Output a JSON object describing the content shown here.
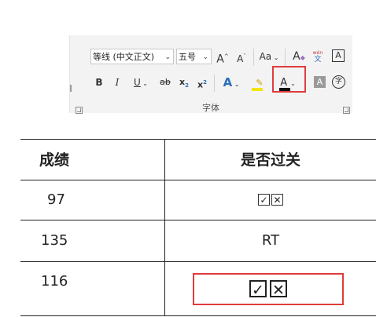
{
  "ribbon": {
    "font_name": "等线 (中文正文)",
    "font_size": "五号",
    "grow_font": "A",
    "shrink_font": "A",
    "change_case": "Aa",
    "clear_format": "A",
    "phonetic_guide_top": "wén",
    "phonetic_guide_bottom": "文",
    "char_border": "A",
    "bold": "B",
    "italic": "I",
    "underline": "U",
    "strikethrough": "ab",
    "subscript": "x",
    "superscript": "x",
    "text_effects": "A",
    "font_color": "A",
    "char_shading": "A",
    "enclose_char": "字",
    "group_label": "字体",
    "accent_red": "#e03c3c",
    "highlight_yellow": "#f2e600"
  },
  "table": {
    "headers": [
      "成绩",
      "是否过关"
    ],
    "rows": [
      {
        "score": "97",
        "pass": "☑☒"
      },
      {
        "score": "135",
        "pass": "RT"
      },
      {
        "score": "116",
        "pass": "✓☒"
      }
    ]
  }
}
